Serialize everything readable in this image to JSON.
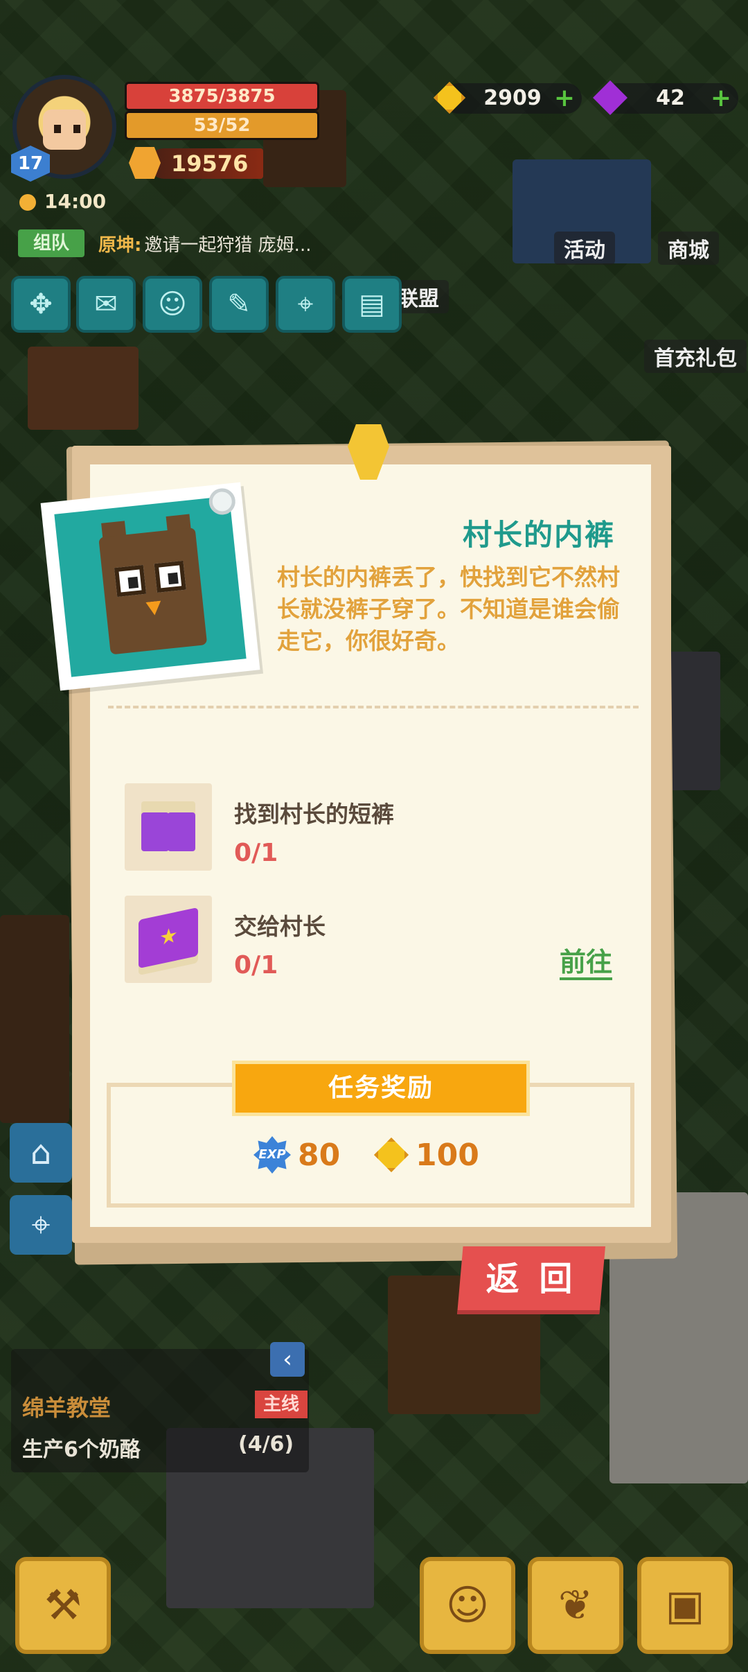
{
  "hud": {
    "level": "17",
    "hp": "3875/3875",
    "hp_ratio": 1.0,
    "energy": "53/52",
    "energy_ratio": 1.0,
    "power": "19576",
    "clock": "14:00",
    "team_tag": "组队",
    "team_sender": "原坤:",
    "team_message": "邀请一起狩猎 庞姆..."
  },
  "resources": {
    "gold": "2909",
    "gems": "42"
  },
  "top_labels": {
    "activity": "活动",
    "shop": "商城",
    "first_pack": "首充礼包",
    "alliance": "联盟"
  },
  "quest": {
    "title": "村长的内裤",
    "description": "村长的内裤丢了，快找到它不然村长就没裤子穿了。不知道是谁会偷走它，你很好奇。",
    "tasks": [
      {
        "name": "找到村长的短裤",
        "progress": "0/1",
        "icon": "purple-shorts-icon"
      },
      {
        "name": "交给村长",
        "progress": "0/1",
        "icon": "purple-book-icon",
        "action": "前往"
      }
    ],
    "reward_title": "任务奖励",
    "rewards": [
      {
        "icon": "exp-icon",
        "icon_text": "EXP",
        "value": "80"
      },
      {
        "icon": "gold-coin-icon",
        "value": "100"
      }
    ],
    "back_label": "返 回"
  },
  "mission": {
    "name": "绵羊教堂",
    "tag": "主线",
    "description": "生产6个奶酪",
    "progress": "(4/6)"
  },
  "colors": {
    "accent_teal": "#1f9a8c",
    "desc_orange": "#e2a23c",
    "progress_red": "#e15a57",
    "go_green": "#47a148",
    "reward_orange": "#f8a70f",
    "back_red": "#e5504f"
  }
}
